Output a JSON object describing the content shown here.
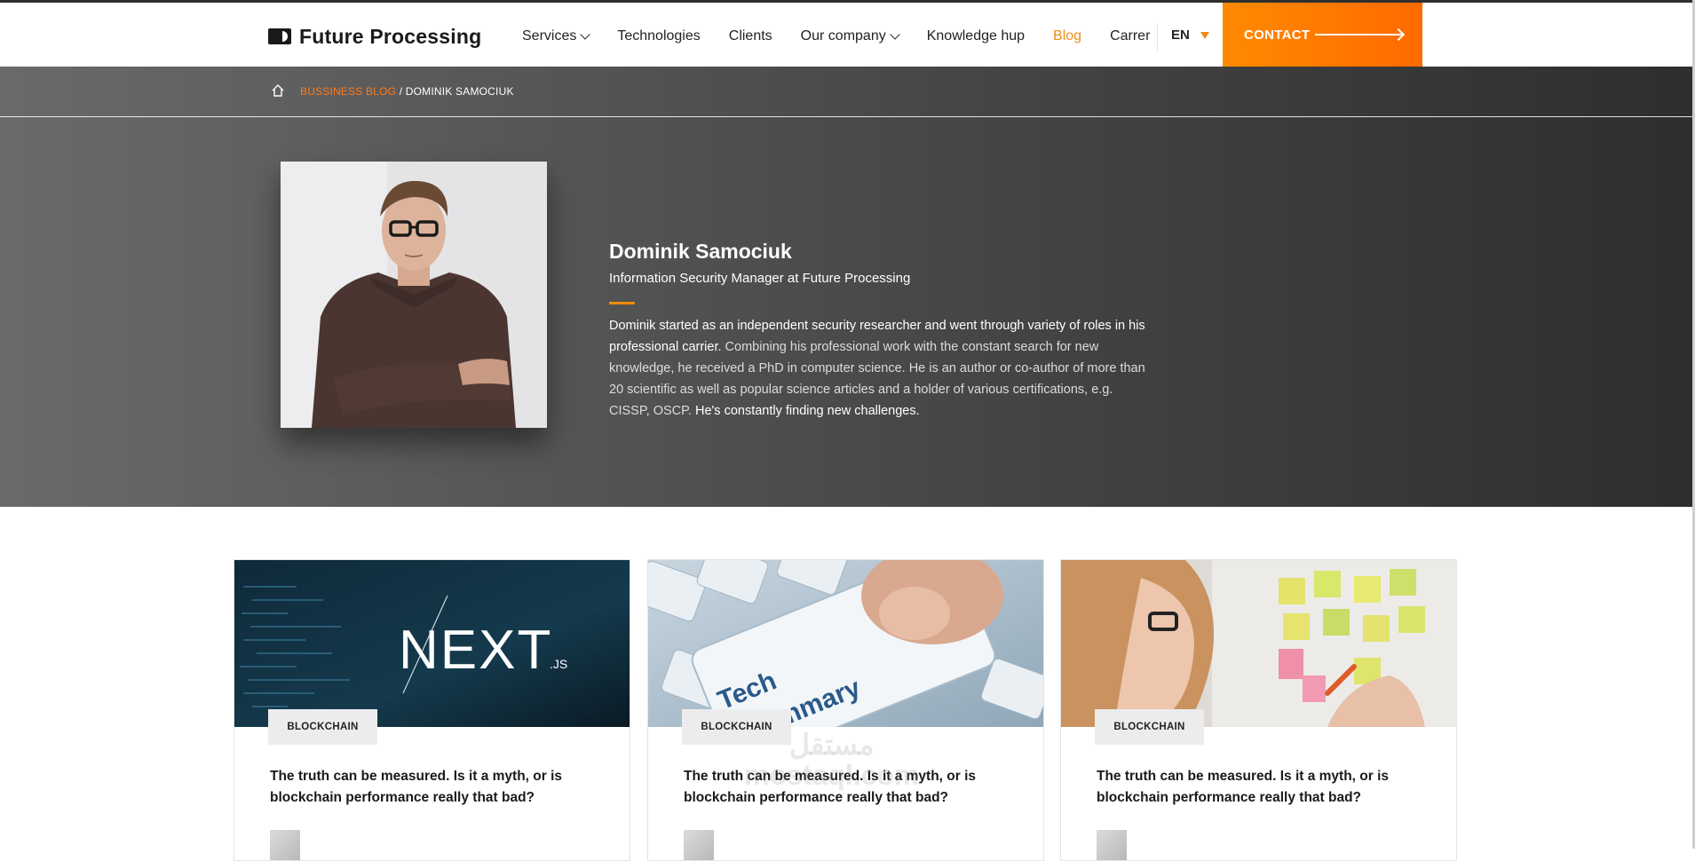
{
  "header": {
    "logo_text": "Future Processing",
    "nav": [
      {
        "label": "Services",
        "dropdown": true,
        "active": false
      },
      {
        "label": "Technologies",
        "dropdown": false,
        "active": false
      },
      {
        "label": "Clients",
        "dropdown": false,
        "active": false
      },
      {
        "label": "Our company",
        "dropdown": true,
        "active": false
      },
      {
        "label": "Knowledge hup",
        "dropdown": false,
        "active": false
      },
      {
        "label": "Blog",
        "dropdown": false,
        "active": true
      },
      {
        "label": "Carrer",
        "dropdown": false,
        "active": false
      }
    ],
    "language": "EN",
    "contact_label": "CONTACT",
    "colors": {
      "accent": "#f08c1a",
      "contact_start": "#ff8a00",
      "contact_end": "#ff6a00"
    }
  },
  "breadcrumb": {
    "link": "BUSSINESS BLOG",
    "separator": " / ",
    "current": "DOMINIK SAMOCIUK"
  },
  "author": {
    "name": "Dominik Samociuk",
    "role": "Information Security Manager at Future Processing",
    "bio_part1": "Dominik started as an independent security researcher and went through variety of roles in his professional carrier.",
    "bio_part2": " Combining his professional work with the constant search for new knowledge, he received a PhD in computer science. He is an author or co-author of more than 20 scientific as well as popular science articles and a holder of various certifications, e.g. CISSP, OSCP.",
    "bio_part3": " He's constantly finding new challenges."
  },
  "cards": [
    {
      "tag": "BLOCKCHAIN",
      "title": "The truth can be measured. Is it a myth, or is blockchain performance really that bad?",
      "image_text": "NEXT",
      "image_sub": ".JS"
    },
    {
      "tag": "BLOCKCHAIN",
      "title": "The truth can be measured. Is it a myth, or is blockchain performance really that bad?",
      "image_text_1": "Tech",
      "image_text_2": "Summary"
    },
    {
      "tag": "BLOCKCHAIN",
      "title": "The truth can be measured. Is it a myth, or is blockchain performance really that bad?"
    }
  ],
  "watermark": {
    "line1": "مستقل",
    "line2": "mostaql.com"
  }
}
